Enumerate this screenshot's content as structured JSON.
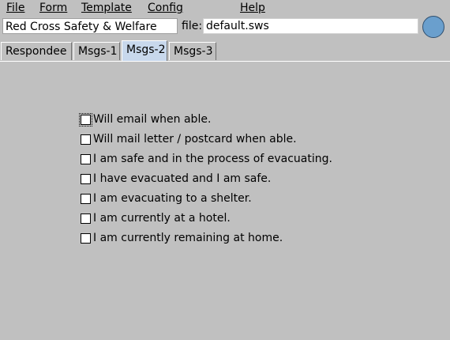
{
  "menu": {
    "file": "File",
    "form": "Form",
    "template": "Template",
    "config": "Config",
    "help": "Help"
  },
  "header": {
    "title": "Red Cross Safety & Welfare",
    "file_label": "file:",
    "file_value": "default.sws",
    "status_color": "#6a9fcd"
  },
  "tabs": [
    {
      "label": "Respondee"
    },
    {
      "label": "Msgs-1"
    },
    {
      "label": "Msgs-2",
      "active": true
    },
    {
      "label": "Msgs-3"
    }
  ],
  "messages": [
    {
      "label": "Will email when able.",
      "checked": false
    },
    {
      "label": "Will mail letter / postcard when able.",
      "checked": false
    },
    {
      "label": "I am safe and in the process of evacuating.",
      "checked": false
    },
    {
      "label": "I have evacuated and I am safe.",
      "checked": false
    },
    {
      "label": "I am evacuating to a shelter.",
      "checked": false
    },
    {
      "label": "I am currently at a hotel.",
      "checked": false
    },
    {
      "label": "I am currently remaining at home.",
      "checked": false
    }
  ]
}
